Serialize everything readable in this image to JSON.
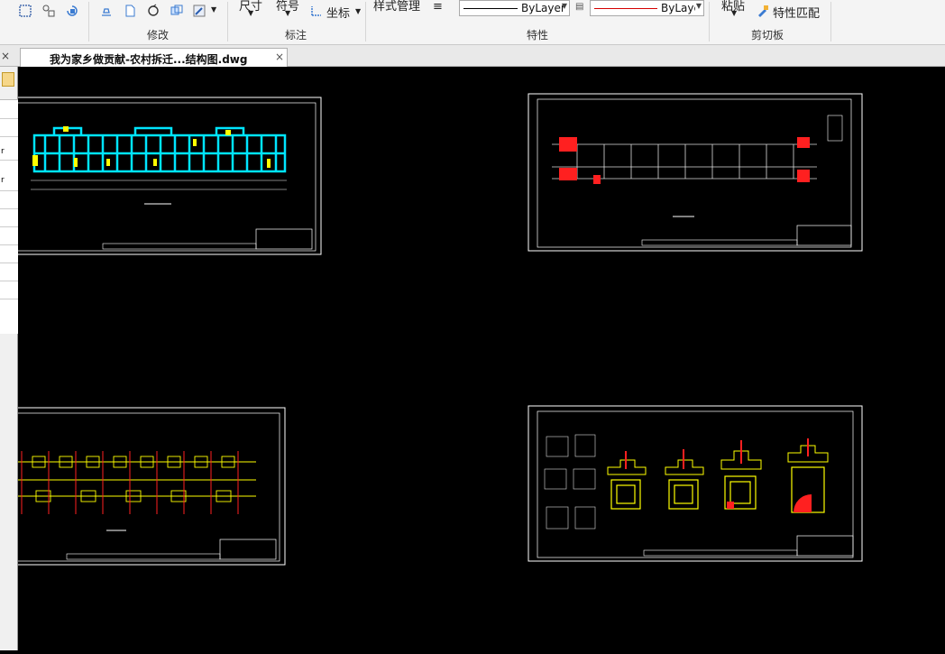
{
  "ribbon": {
    "groups": {
      "modify": "修改",
      "annotate": "标注",
      "properties": "特性",
      "clipboard": "剪切板"
    },
    "annotate": {
      "dimension": "尺寸",
      "symbol": "符号",
      "coordinate": "坐标"
    },
    "properties": {
      "style_manager": "样式管理",
      "linetype_value": "ByLayer",
      "color_value": "ByLayer"
    },
    "clipboard": {
      "paste": "粘贴",
      "match_properties": "特性匹配"
    }
  },
  "tabs": {
    "document_title": "我为家乡做贡献-农村拆迁...结构图.dwg",
    "close_glyph": "×"
  },
  "palette": {
    "close_glyph": "×",
    "r_label": "r"
  },
  "colors": {
    "canvas_bg": "#000000",
    "drawing_white": "#ffffff",
    "beam_cyan": "#00e5ff",
    "highlight_yellow": "#ffff00",
    "section_red": "#ff2020",
    "ribbon_bg": "#f4f4f4",
    "color_line_red": "#d40000"
  }
}
